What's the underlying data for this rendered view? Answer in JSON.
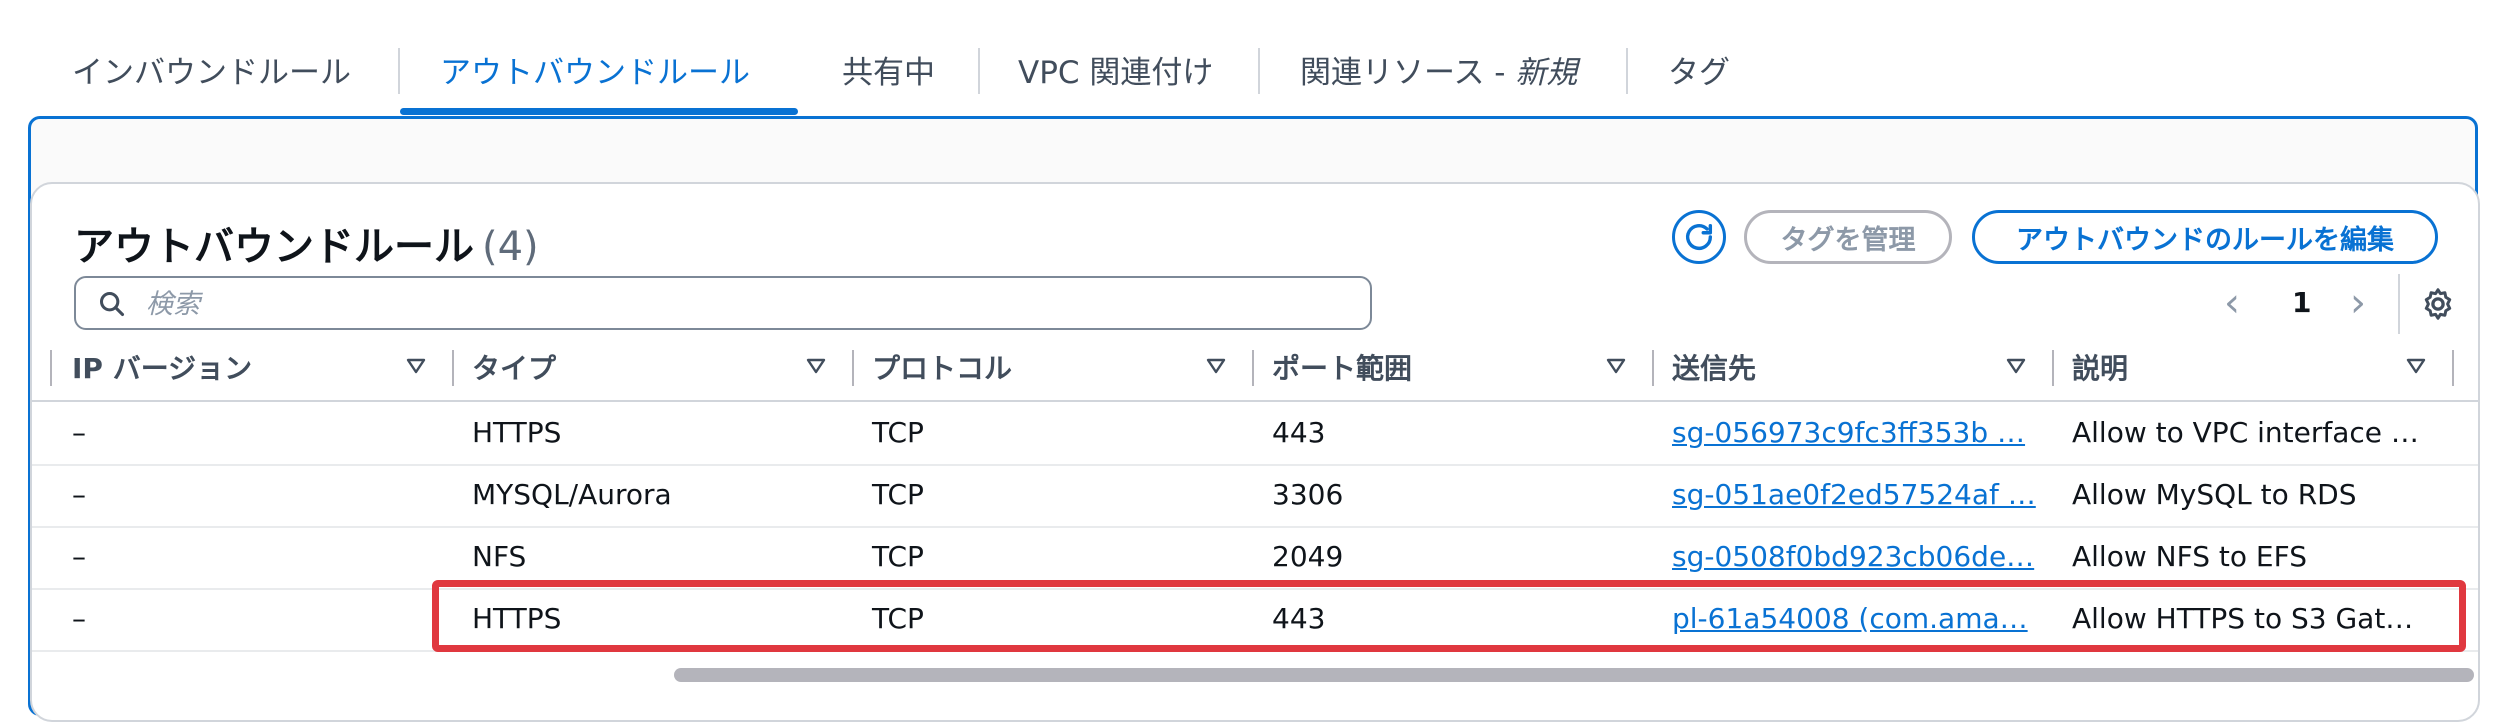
{
  "tabs": [
    {
      "label": "インバウンドルール"
    },
    {
      "label": "アウトバウンドルール"
    },
    {
      "label": "共有中"
    },
    {
      "label": "VPC 関連付け"
    },
    {
      "label": "関連リソース - ",
      "badge": "新規"
    },
    {
      "label": "タグ"
    }
  ],
  "active_tab": "アウトバウンドルール",
  "panel": {
    "title": "アウトバウンドルール",
    "count": "(4)",
    "manage_tags_label": "タグを管理",
    "edit_rules_label": "アウトバウンドのルールを編集",
    "search_placeholder": "検索",
    "page": "1"
  },
  "table": {
    "columns": [
      "IP バージョン",
      "タイプ",
      "プロトコル",
      "ポート範囲",
      "送信先",
      "説明"
    ],
    "rows": [
      {
        "ip_version": "–",
        "type": "HTTPS",
        "protocol": "TCP",
        "port_range": "443",
        "destination": "sg-056973c9fc3ff353b …",
        "description": "Allow to VPC interface …"
      },
      {
        "ip_version": "–",
        "type": "MYSQL/Aurora",
        "protocol": "TCP",
        "port_range": "3306",
        "destination": "sg-051ae0f2ed57524af …",
        "description": "Allow MySQL to RDS"
      },
      {
        "ip_version": "–",
        "type": "NFS",
        "protocol": "TCP",
        "port_range": "2049",
        "destination": "sg-0508f0bd923cb06de…",
        "description": "Allow NFS to EFS"
      },
      {
        "ip_version": "–",
        "type": "HTTPS",
        "protocol": "TCP",
        "port_range": "443",
        "destination": "pl-61a54008 (com.ama…",
        "description": "Allow HTTPS to S3 Gat…"
      }
    ]
  },
  "colors": {
    "accent": "#0972d3",
    "highlight": "#e0383f",
    "text": "#0f141a",
    "muted": "#8d99a8"
  },
  "icons": [
    "refresh-icon",
    "search-icon",
    "chevron-left-icon",
    "chevron-right-icon",
    "gear-icon",
    "sort-caret-icon"
  ]
}
